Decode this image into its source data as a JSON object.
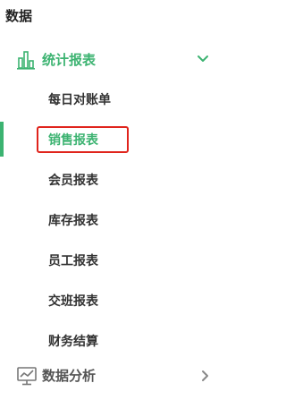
{
  "section": {
    "title": "数据"
  },
  "report_group": {
    "label": "统计报表",
    "icon": "bar-chart-icon",
    "expanded": true,
    "chevron": "chevron-down-icon",
    "accent_color": "#3cb371",
    "items": [
      {
        "label": "每日对账单"
      },
      {
        "label": "销售报表",
        "active": true,
        "highlighted": true
      },
      {
        "label": "会员报表"
      },
      {
        "label": "库存报表"
      },
      {
        "label": "员工报表"
      },
      {
        "label": "交班报表"
      },
      {
        "label": "财务结算"
      }
    ]
  },
  "analysis_group": {
    "label": "数据分析",
    "icon": "monitor-chart-icon",
    "expanded": false,
    "chevron": "chevron-right-icon"
  },
  "highlight_color": "#e0241c"
}
